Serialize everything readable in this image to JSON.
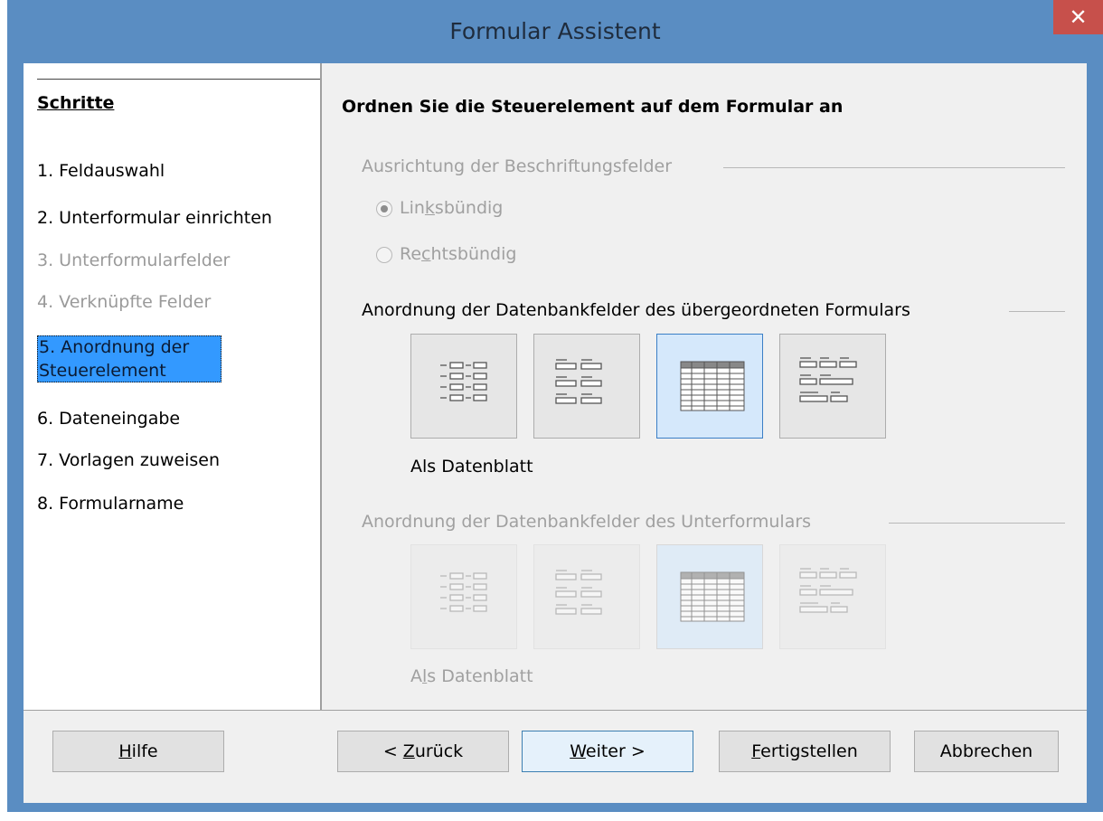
{
  "window": {
    "title": "Formular Assistent",
    "close_symbol": "✕"
  },
  "steps": {
    "header": "Schritte",
    "items": [
      {
        "label": "1. Feldauswahl",
        "state": "enabled"
      },
      {
        "label": "2. Unterformular einrichten",
        "state": "enabled"
      },
      {
        "label": "3. Unterformularfelder",
        "state": "disabled"
      },
      {
        "label": "4. Verknüpfte Felder",
        "state": "disabled"
      },
      {
        "label_line1": "5. Anordnung der",
        "label_line2": "Steuerelement",
        "state": "active"
      },
      {
        "label": "6. Dateneingabe",
        "state": "enabled"
      },
      {
        "label": "7. Vorlagen zuweisen",
        "state": "enabled"
      },
      {
        "label": "8. Formularname",
        "state": "enabled"
      }
    ]
  },
  "content": {
    "title": "Ordnen Sie die Steuerelement auf dem Formular an",
    "label_alignment": {
      "group_label": "Ausrichtung der Beschriftungsfelder",
      "options": [
        {
          "pre": "Lin",
          "mnemonic": "k",
          "post": "sbündig",
          "checked": true
        },
        {
          "pre": "Re",
          "mnemonic": "c",
          "post": "htsbündig",
          "checked": false
        }
      ]
    },
    "main_form_layout": {
      "group_label": "Anordnung der Datenbankfelder des übergeordneten Formulars",
      "selected_index": 2,
      "selected_label": "Als Datenblatt",
      "icons": [
        "columnar-left-labels-icon",
        "columnar-top-labels-icon",
        "datasheet-icon",
        "blocks-top-labels-icon"
      ]
    },
    "sub_form_layout": {
      "group_label": "Anordnung der Datenbankfelder des Unterformulars",
      "selected_index": 2,
      "selected_label_pre": "A",
      "selected_label_mnemonic": "l",
      "selected_label_post": "s Datenblatt",
      "icons": [
        "columnar-left-labels-icon",
        "columnar-top-labels-icon",
        "datasheet-icon",
        "blocks-top-labels-icon"
      ]
    }
  },
  "buttons": {
    "help": {
      "mnemonic": "H",
      "rest": "ilfe"
    },
    "back": {
      "pre": "< ",
      "mnemonic": "Z",
      "rest": "urück"
    },
    "next": {
      "mnemonic": "W",
      "rest": "eiter >"
    },
    "finish": {
      "mnemonic": "F",
      "rest": "ertigstellen"
    },
    "cancel": {
      "label": "Abbrechen"
    }
  }
}
